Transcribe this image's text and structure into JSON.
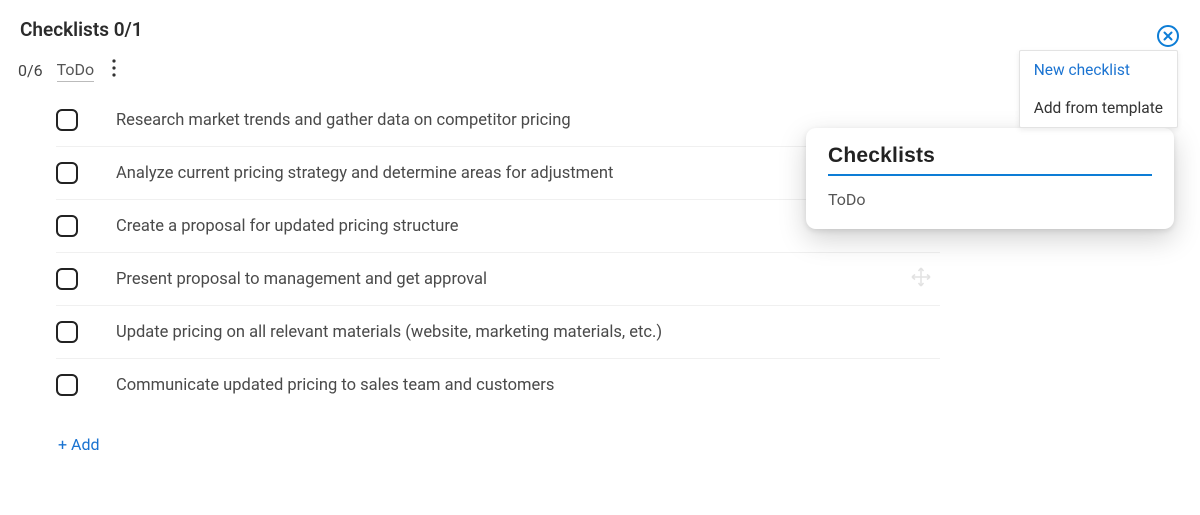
{
  "header": {
    "title": "Checklists 0/1"
  },
  "sub": {
    "count": "0/6",
    "listName": "ToDo"
  },
  "items": [
    {
      "text": "Research market trends and gather data on competitor pricing"
    },
    {
      "text": "Analyze current pricing strategy and determine areas for adjustment"
    },
    {
      "text": "Create a proposal for updated pricing structure"
    },
    {
      "text": "Present proposal to management and get approval",
      "dragVisible": true
    },
    {
      "text": "Update pricing on all relevant materials (website, marketing materials, etc.)"
    },
    {
      "text": "Communicate updated pricing to sales team and customers"
    }
  ],
  "addLabel": "+ Add",
  "dropdown": {
    "newLabel": "New checklist",
    "templateLabel": "Add from template"
  },
  "popover": {
    "title": "Checklists",
    "list1": "ToDo"
  }
}
